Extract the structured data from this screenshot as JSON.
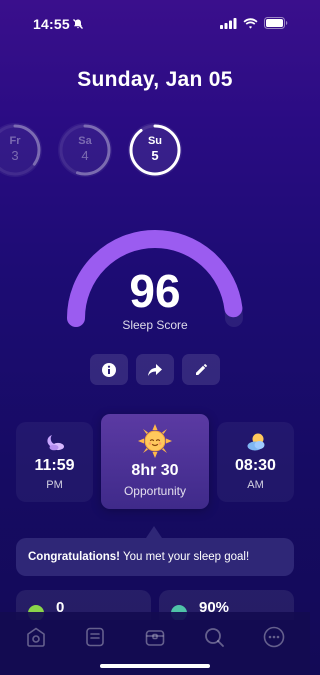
{
  "status_bar": {
    "time": "14:55"
  },
  "header": {
    "date": "Sunday, Jan 05"
  },
  "days": [
    {
      "name": "Fr",
      "num": "3",
      "progress": 0.35,
      "selected": false
    },
    {
      "name": "Sa",
      "num": "4",
      "progress": 0.55,
      "selected": false
    },
    {
      "name": "Su",
      "num": "5",
      "progress": 0.9,
      "selected": true
    }
  ],
  "score": {
    "value": "96",
    "label": "Sleep Score",
    "fraction": 0.96
  },
  "times": {
    "bedtime": {
      "value": "11:59",
      "period": "PM",
      "icon": "moon-icon"
    },
    "opportunity": {
      "value": "8hr 30",
      "label": "Opportunity",
      "icon": "sun-icon"
    },
    "wake": {
      "value": "08:30",
      "period": "AM",
      "icon": "cloud-sun-icon"
    }
  },
  "congrats": {
    "bold": "Congratulations!",
    "text": " You met your sleep goal!"
  },
  "stats": [
    {
      "value": "0",
      "color": "#8bd64a"
    },
    {
      "value": "90%",
      "color": "#4fc3a8"
    }
  ],
  "colors": {
    "accent": "#9b5cf0",
    "background": "#1d0c74"
  }
}
